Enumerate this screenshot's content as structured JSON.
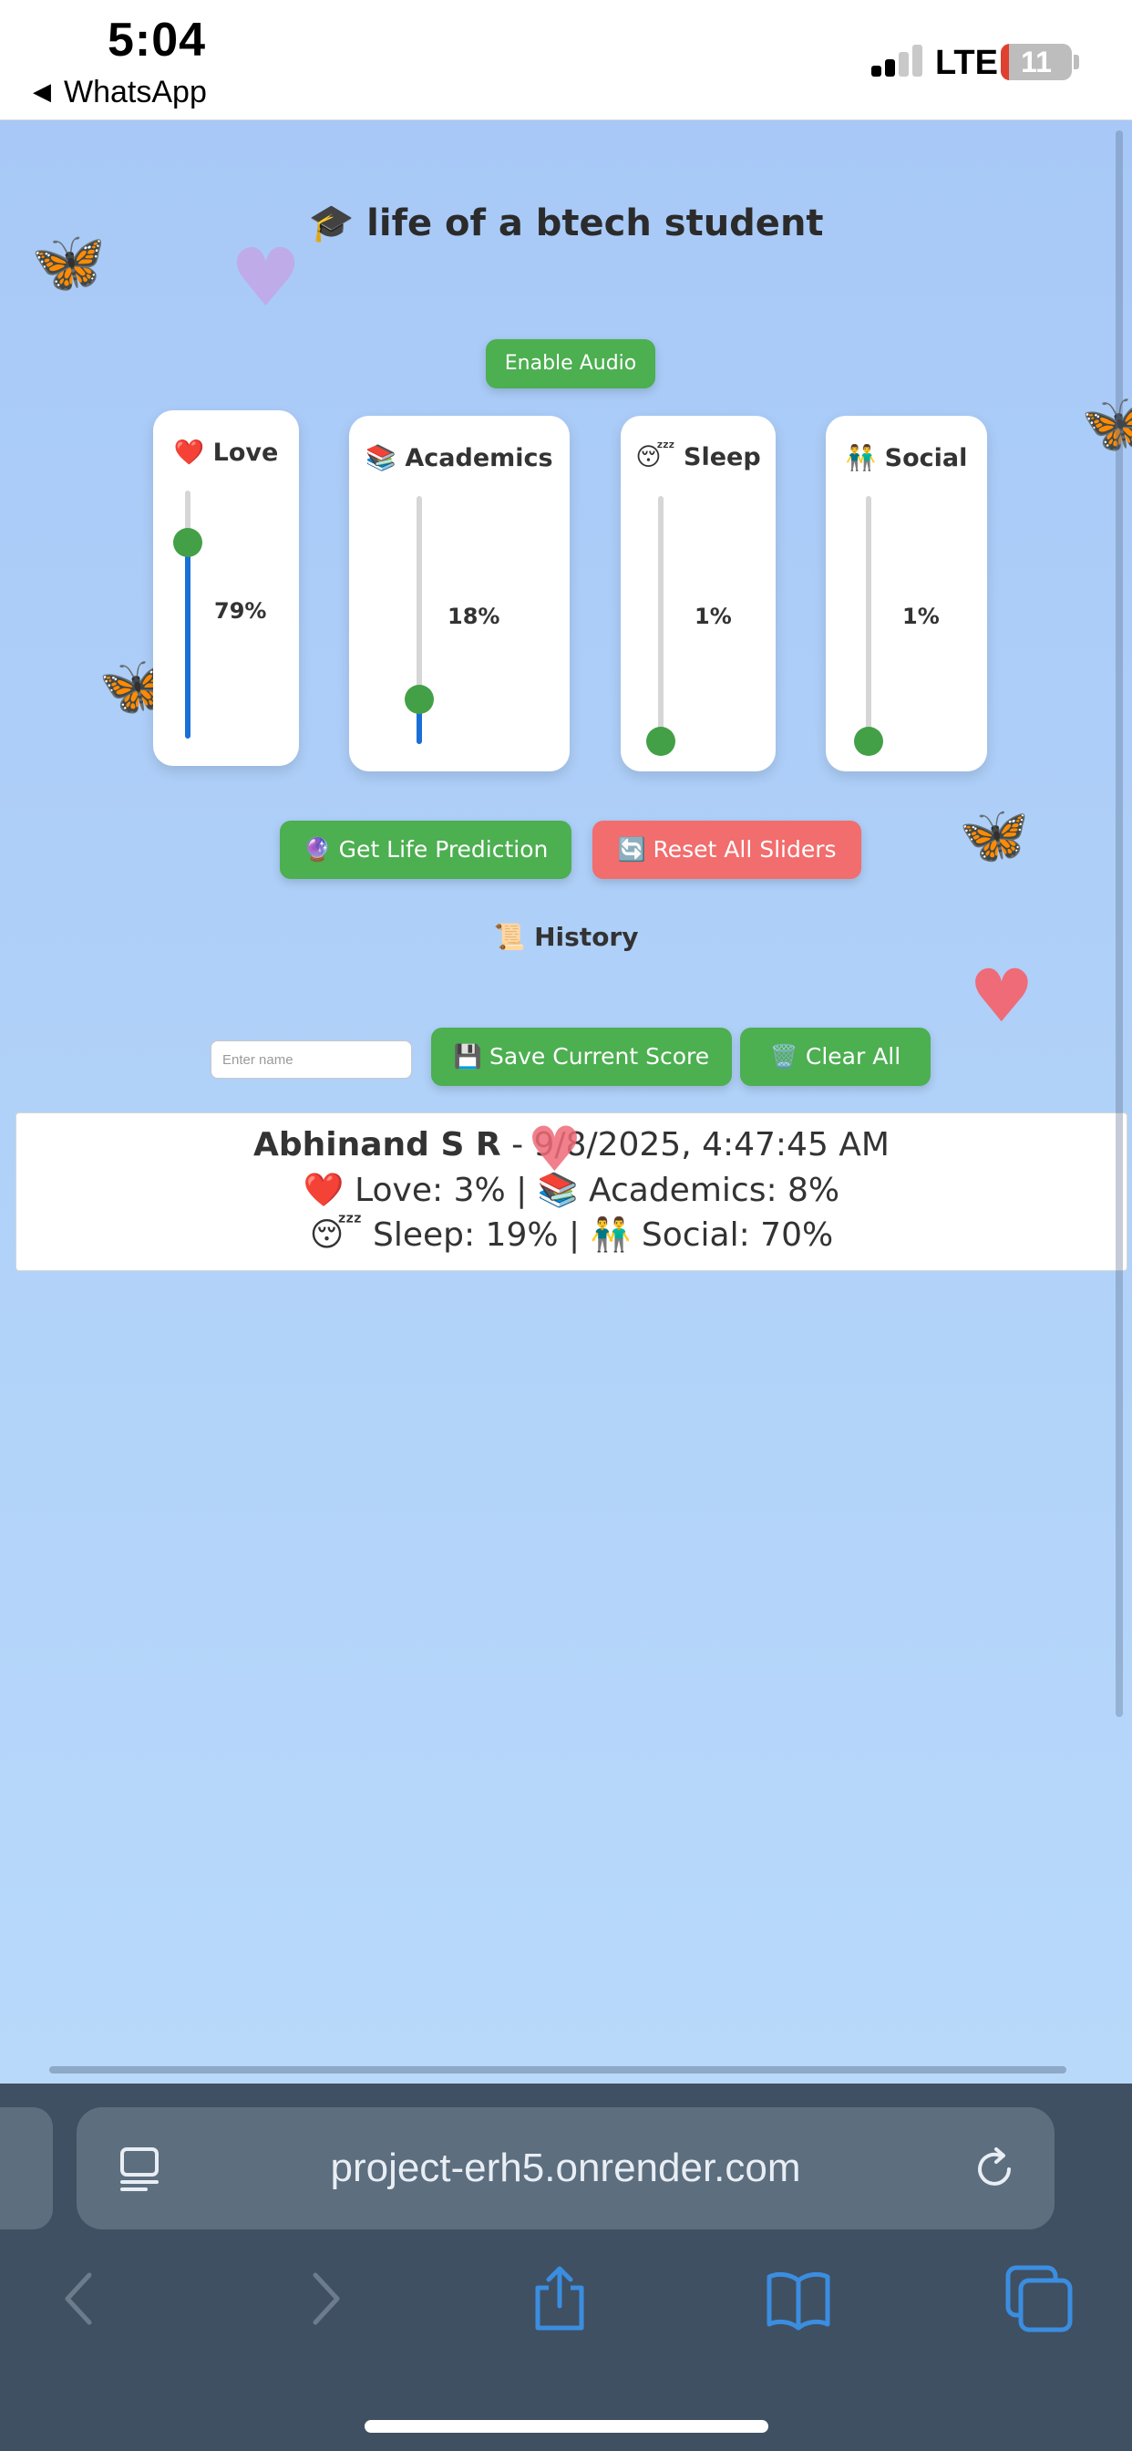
{
  "status_bar": {
    "time": "5:04",
    "back_app": "WhatsApp",
    "network": "LTE",
    "battery": "11"
  },
  "page": {
    "title": "🎓 life of a btech student",
    "audio_button": "Enable Audio",
    "sliders": [
      {
        "emoji": "❤️",
        "name": "Love",
        "value": 79,
        "display": "79%"
      },
      {
        "emoji": "📚",
        "name": "Academics",
        "value": 18,
        "display": "18%"
      },
      {
        "emoji": "😴",
        "name": "Sleep",
        "value": 1,
        "display": "1%"
      },
      {
        "emoji": "👬",
        "name": "Social",
        "value": 1,
        "display": "1%"
      }
    ],
    "predict_button": "🔮 Get Life Prediction",
    "reset_button": "🔄 Reset All Sliders",
    "history_heading": "📜 History",
    "name_input": {
      "placeholder": "Enter name",
      "value": ""
    },
    "save_button": "💾 Save Current Score",
    "clear_button": "🗑️ Clear All",
    "history": [
      {
        "name": "Abhinand S R",
        "date_sep": " - ",
        "datetime": "9/8/2025, 4:47:45 AM",
        "line2": "❤️ Love: 3% | 📚 Academics: 8%",
        "line3": "😴 Sleep: 19% | 👬 Social: 70%"
      }
    ],
    "decorations": {
      "butterfly": "🦋",
      "heart": "♥"
    }
  },
  "browser": {
    "url": "project-erh5.onrender.com"
  },
  "colors": {
    "background": "#a8c9f7",
    "green_button": "#4caf50",
    "red_button": "#f26d6d",
    "slider_fill": "#1a6fd6",
    "slider_thumb": "#43a047",
    "safari_chrome": "#3f5062",
    "safari_icon_blue": "#3b8de0"
  }
}
